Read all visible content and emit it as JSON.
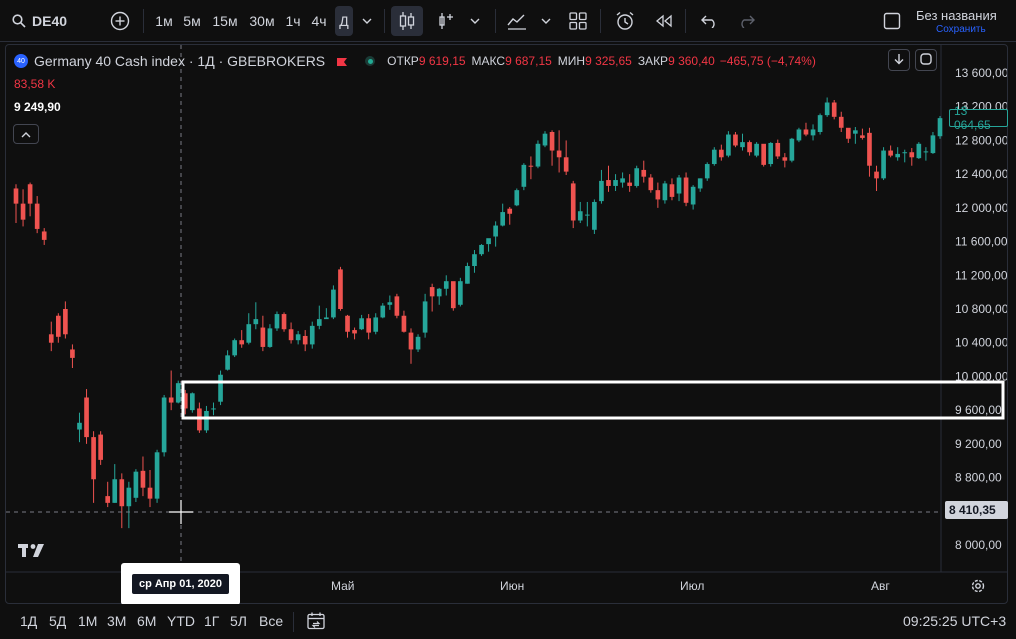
{
  "toolbar": {
    "symbol": "DE40",
    "intervals": [
      "1м",
      "5м",
      "15м",
      "30м",
      "1ч",
      "4ч",
      "Д"
    ],
    "active_interval": "Д",
    "layout_name": "Без названия",
    "save_label": "Сохранить"
  },
  "legend": {
    "symbol_badge": "40",
    "title": "Germany 40 Cash index · 1Д · GBEBROKERS",
    "open_label": "ОТКР",
    "open_value": "9 619,15",
    "high_label": "МАКС",
    "high_value": "9 687,15",
    "low_label": "МИН",
    "low_value": "9 325,65",
    "close_label": "ЗАКР",
    "close_value": "9 360,40",
    "change_value": "−465,75 (−4,74%)",
    "volume_value": "83,58 K",
    "indicator_value": "9 249,90"
  },
  "price_axis": {
    "ticks": [
      "13 600,00",
      "13 200,00",
      "12 800,00",
      "12 400,00",
      "12 000,00",
      "11 600,00",
      "11 200,00",
      "10 800,00",
      "10 400,00",
      "10 000,00",
      "9 600,00",
      "9 200,00",
      "8 800,00",
      "8 400,00",
      "8 000,00"
    ],
    "last_price_label": "13 064,65",
    "crosshair_price_label": "8 410,35"
  },
  "time_axis": {
    "labels": [
      "Май",
      "Июн",
      "Июл",
      "Авг"
    ],
    "crosshair_date_label": "ср Апр 01, 2020"
  },
  "bottom": {
    "ranges": [
      "1Д",
      "5Д",
      "1М",
      "3М",
      "6М",
      "YTD",
      "1Г",
      "5Л",
      "Все"
    ],
    "clock": "09:25:25 UTC+3"
  },
  "colors": {
    "up": "#26a69a",
    "down": "#ef5350",
    "background": "#0f0f0f",
    "text": "#d1d4dc",
    "accent": "#2962ff"
  },
  "chart_data": {
    "type": "candlestick",
    "title": "Germany 40 Cash index · 1Д · GBEBROKERS",
    "y_range": [
      7800,
      13800
    ],
    "candles": [
      [
        12230,
        12280,
        11820,
        12050
      ],
      [
        12050,
        12220,
        11780,
        11860
      ],
      [
        12280,
        12300,
        11900,
        12050
      ],
      [
        12050,
        12140,
        11700,
        11750
      ],
      [
        11720,
        11760,
        11560,
        11620
      ],
      [
        10500,
        10650,
        10300,
        10400
      ],
      [
        10720,
        10750,
        10400,
        10470
      ],
      [
        10800,
        10890,
        10450,
        10500
      ],
      [
        10320,
        10380,
        10100,
        10220
      ],
      [
        9370,
        9570,
        9220,
        9450
      ],
      [
        9750,
        9850,
        9200,
        9280
      ],
      [
        9280,
        9350,
        8500,
        8780
      ],
      [
        9310,
        9350,
        8950,
        9010
      ],
      [
        8580,
        8750,
        8450,
        8500
      ],
      [
        8500,
        8960,
        8500,
        8780
      ],
      [
        8780,
        8850,
        8200,
        8460
      ],
      [
        8460,
        8750,
        8200,
        8680
      ],
      [
        8560,
        8900,
        8510,
        8870
      ],
      [
        8880,
        9050,
        8580,
        8680
      ],
      [
        8680,
        8890,
        8450,
        8550
      ],
      [
        8550,
        9130,
        8500,
        9100
      ],
      [
        9100,
        9780,
        9050,
        9750
      ],
      [
        9750,
        10070,
        9600,
        9690
      ],
      [
        9690,
        9950,
        9680,
        9920
      ],
      [
        9800,
        9840,
        9550,
        9620
      ],
      [
        9600,
        9810,
        9570,
        9800
      ],
      [
        9620,
        9690,
        9330,
        9360
      ],
      [
        9360,
        9650,
        9330,
        9590
      ],
      [
        9610,
        9690,
        9540,
        9620
      ],
      [
        9700,
        10070,
        9660,
        10020
      ],
      [
        10080,
        10310,
        10070,
        10250
      ],
      [
        10250,
        10450,
        10230,
        10430
      ],
      [
        10430,
        10550,
        10340,
        10380
      ],
      [
        10400,
        10750,
        10380,
        10620
      ],
      [
        10620,
        10880,
        10560,
        10680
      ],
      [
        10580,
        10720,
        10300,
        10350
      ],
      [
        10350,
        10620,
        10340,
        10570
      ],
      [
        10570,
        10770,
        10540,
        10740
      ],
      [
        10740,
        10760,
        10530,
        10560
      ],
      [
        10560,
        10640,
        10390,
        10430
      ],
      [
        10430,
        10540,
        10380,
        10500
      ],
      [
        10480,
        10550,
        10300,
        10380
      ],
      [
        10380,
        10650,
        10330,
        10600
      ],
      [
        10600,
        10840,
        10560,
        10680
      ],
      [
        10680,
        10810,
        10690,
        10700
      ],
      [
        10700,
        11080,
        10680,
        11030
      ],
      [
        11270,
        11300,
        10780,
        10800
      ],
      [
        10720,
        10730,
        10460,
        10530
      ],
      [
        10550,
        10580,
        10440,
        10510
      ],
      [
        10560,
        10730,
        10550,
        10690
      ],
      [
        10690,
        10740,
        10440,
        10520
      ],
      [
        10530,
        10750,
        10500,
        10700
      ],
      [
        10700,
        10870,
        10690,
        10840
      ],
      [
        10850,
        10960,
        10790,
        10880
      ],
      [
        10950,
        10980,
        10690,
        10720
      ],
      [
        10720,
        10780,
        10520,
        10530
      ],
      [
        10520,
        10570,
        10150,
        10320
      ],
      [
        10320,
        10500,
        10290,
        10470
      ],
      [
        10520,
        10980,
        10460,
        10890
      ],
      [
        11060,
        11100,
        10770,
        10950
      ],
      [
        10950,
        11050,
        10850,
        11040
      ],
      [
        11040,
        11200,
        10960,
        11130
      ],
      [
        11130,
        11080,
        10780,
        10810
      ],
      [
        10850,
        11170,
        10830,
        11130
      ],
      [
        11100,
        11350,
        11100,
        11310
      ],
      [
        11310,
        11500,
        11230,
        11450
      ],
      [
        11450,
        11570,
        11430,
        11560
      ],
      [
        11570,
        11630,
        11480,
        11640
      ],
      [
        11660,
        11840,
        11540,
        11790
      ],
      [
        11790,
        12050,
        11780,
        11950
      ],
      [
        11990,
        12010,
        11800,
        11930
      ],
      [
        12030,
        12230,
        12020,
        12210
      ],
      [
        12250,
        12530,
        12210,
        12510
      ],
      [
        12500,
        12610,
        12340,
        12490
      ],
      [
        12490,
        12800,
        12470,
        12760
      ],
      [
        12740,
        12910,
        12720,
        12880
      ],
      [
        12900,
        12920,
        12500,
        12680
      ],
      [
        12680,
        12920,
        12420,
        12600
      ],
      [
        12600,
        12800,
        12390,
        12430
      ],
      [
        12290,
        12320,
        11760,
        11850
      ],
      [
        11850,
        12070,
        11820,
        11960
      ],
      [
        11920,
        12070,
        11780,
        11920
      ],
      [
        11740,
        12100,
        11690,
        12070
      ],
      [
        12080,
        12450,
        12050,
        12320
      ],
      [
        12330,
        12500,
        12190,
        12260
      ],
      [
        12260,
        12400,
        12200,
        12330
      ],
      [
        12300,
        12420,
        12240,
        12350
      ],
      [
        12300,
        12400,
        12190,
        12260
      ],
      [
        12260,
        12500,
        12240,
        12470
      ],
      [
        12450,
        12560,
        12300,
        12370
      ],
      [
        12360,
        12400,
        12180,
        12210
      ],
      [
        12210,
        12300,
        12000,
        12100
      ],
      [
        12090,
        12320,
        12050,
        12290
      ],
      [
        12280,
        12350,
        12090,
        12130
      ],
      [
        12170,
        12390,
        12080,
        12360
      ],
      [
        12360,
        12420,
        12020,
        12060
      ],
      [
        12040,
        12270,
        11980,
        12250
      ],
      [
        12230,
        12350,
        12190,
        12350
      ],
      [
        12350,
        12540,
        12320,
        12520
      ],
      [
        12520,
        12720,
        12500,
        12690
      ],
      [
        12690,
        12750,
        12560,
        12600
      ],
      [
        12620,
        12910,
        12600,
        12870
      ],
      [
        12870,
        12900,
        12720,
        12740
      ],
      [
        12720,
        12880,
        12680,
        12780
      ],
      [
        12780,
        12800,
        12620,
        12660
      ],
      [
        12620,
        12780,
        12600,
        12760
      ],
      [
        12760,
        12720,
        12490,
        12510
      ],
      [
        12520,
        12780,
        12490,
        12770
      ],
      [
        12770,
        12810,
        12580,
        12610
      ],
      [
        12600,
        12650,
        12480,
        12560
      ],
      [
        12560,
        12830,
        12540,
        12820
      ],
      [
        12800,
        12950,
        12780,
        12930
      ],
      [
        12930,
        13010,
        12850,
        12870
      ],
      [
        12860,
        12990,
        12800,
        12930
      ],
      [
        12900,
        13120,
        12870,
        13100
      ],
      [
        13100,
        13310,
        13080,
        13250
      ],
      [
        13250,
        13280,
        13050,
        13080
      ],
      [
        13080,
        13140,
        12900,
        12950
      ],
      [
        12950,
        12940,
        12770,
        12820
      ],
      [
        12880,
        12960,
        12760,
        12920
      ],
      [
        12860,
        12940,
        12810,
        12830
      ],
      [
        12890,
        12950,
        12370,
        12500
      ],
      [
        12430,
        12500,
        12200,
        12350
      ],
      [
        12350,
        12720,
        12330,
        12680
      ],
      [
        12680,
        12740,
        12600,
        12620
      ],
      [
        12600,
        12720,
        12560,
        12640
      ],
      [
        12650,
        12690,
        12540,
        12660
      ],
      [
        12660,
        12710,
        12500,
        12600
      ],
      [
        12590,
        12780,
        12580,
        12760
      ],
      [
        12670,
        12720,
        12560,
        12670
      ],
      [
        12650,
        12900,
        12640,
        12860
      ],
      [
        12850,
        13090,
        12820,
        13064.65
      ]
    ]
  }
}
